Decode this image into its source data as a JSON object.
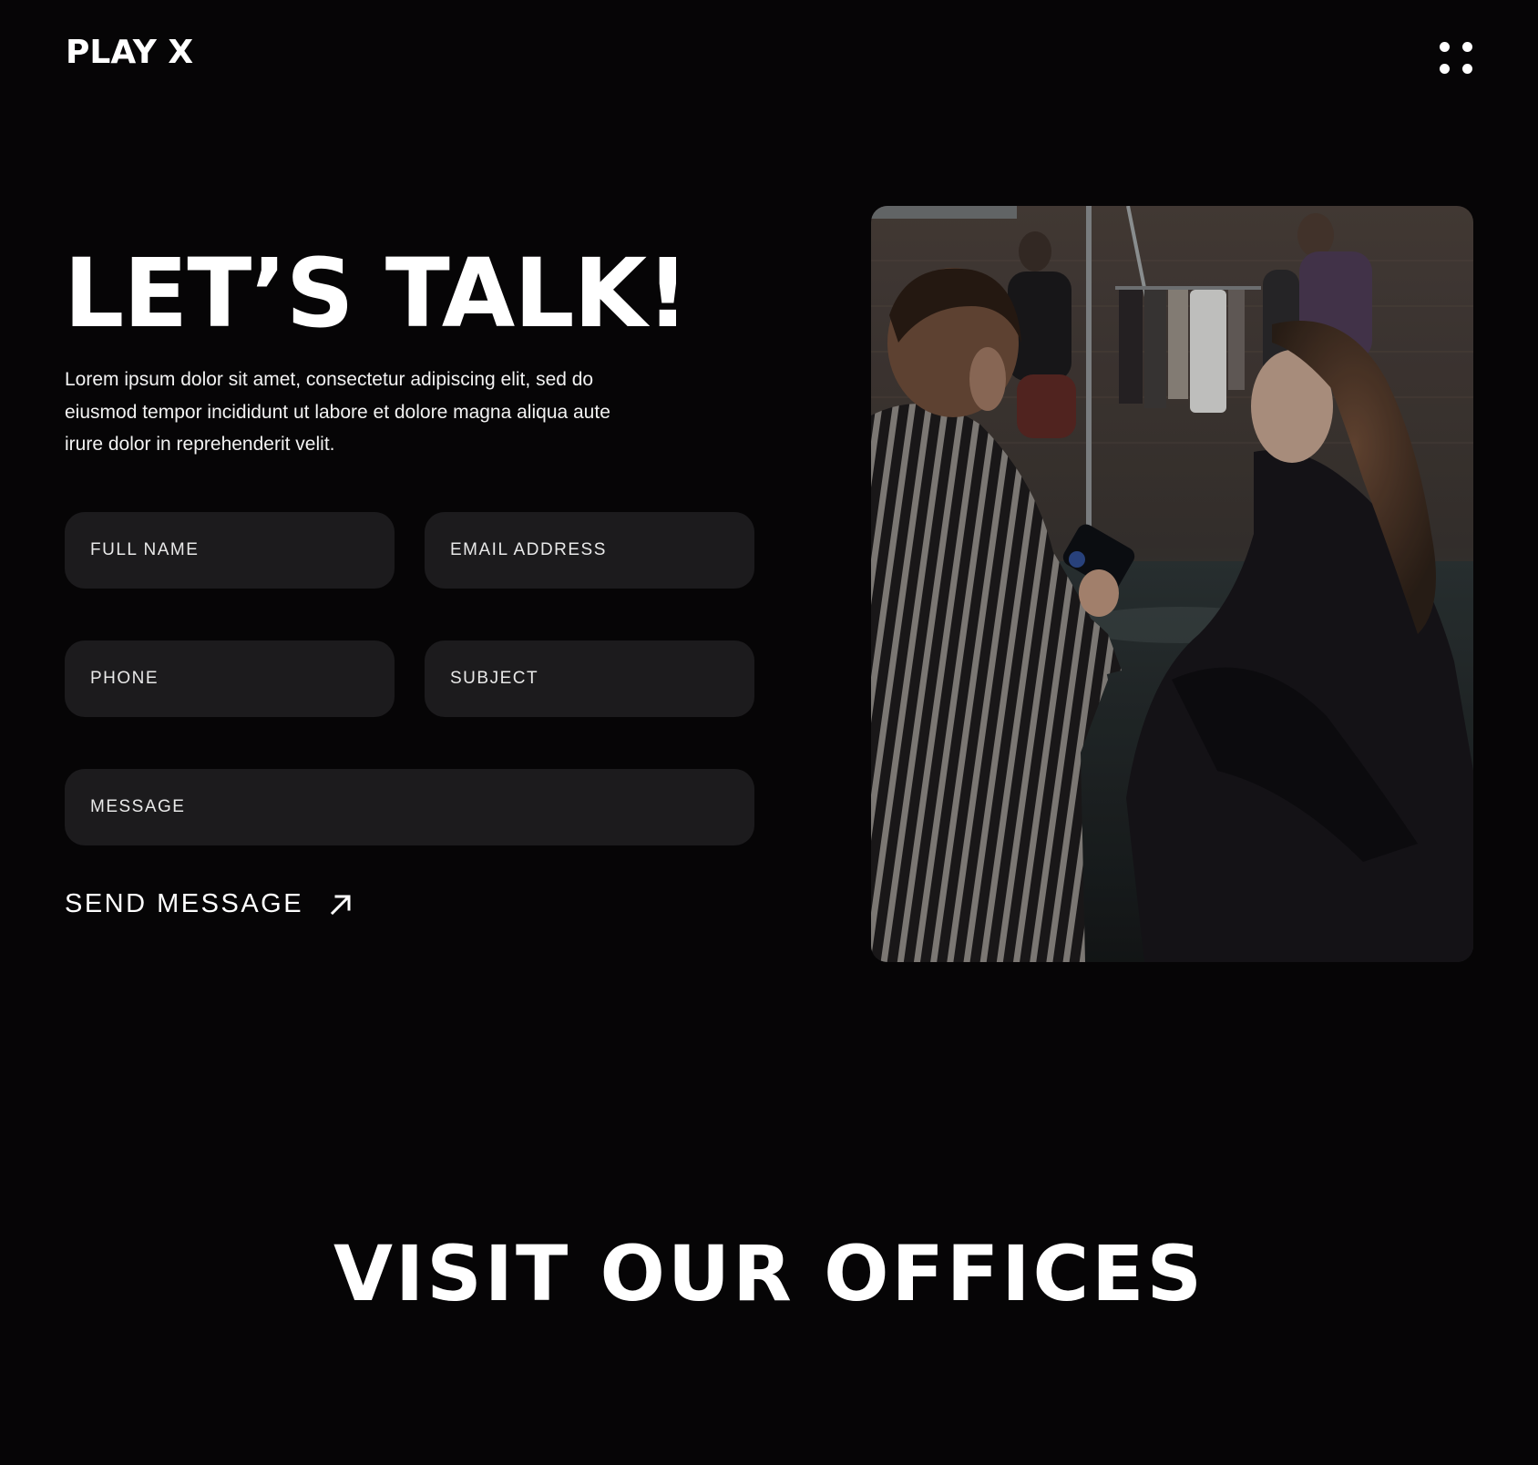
{
  "header": {
    "logo": "PLAY X",
    "menu_icon": "dots-grid-icon"
  },
  "hero": {
    "title": "LET’S TALK!",
    "intro": "Lorem ipsum dolor sit amet, consectetur adipiscing elit, sed do eiusmod tempor incididunt ut labore et dolore magna aliqua aute irure dolor in reprehenderit velit."
  },
  "form": {
    "full_name_placeholder": "FULL NAME",
    "email_placeholder": "EMAIL ADDRESS",
    "phone_placeholder": "PHONE",
    "subject_placeholder": "SUBJECT",
    "message_placeholder": "MESSAGE",
    "send_label": "SEND MESSAGE",
    "send_icon": "arrow-up-right-icon"
  },
  "offices": {
    "title": "VISIT OUR OFFICES"
  },
  "colors": {
    "background": "#060506",
    "field_background": "#1c1b1d",
    "text": "#ffffff"
  }
}
